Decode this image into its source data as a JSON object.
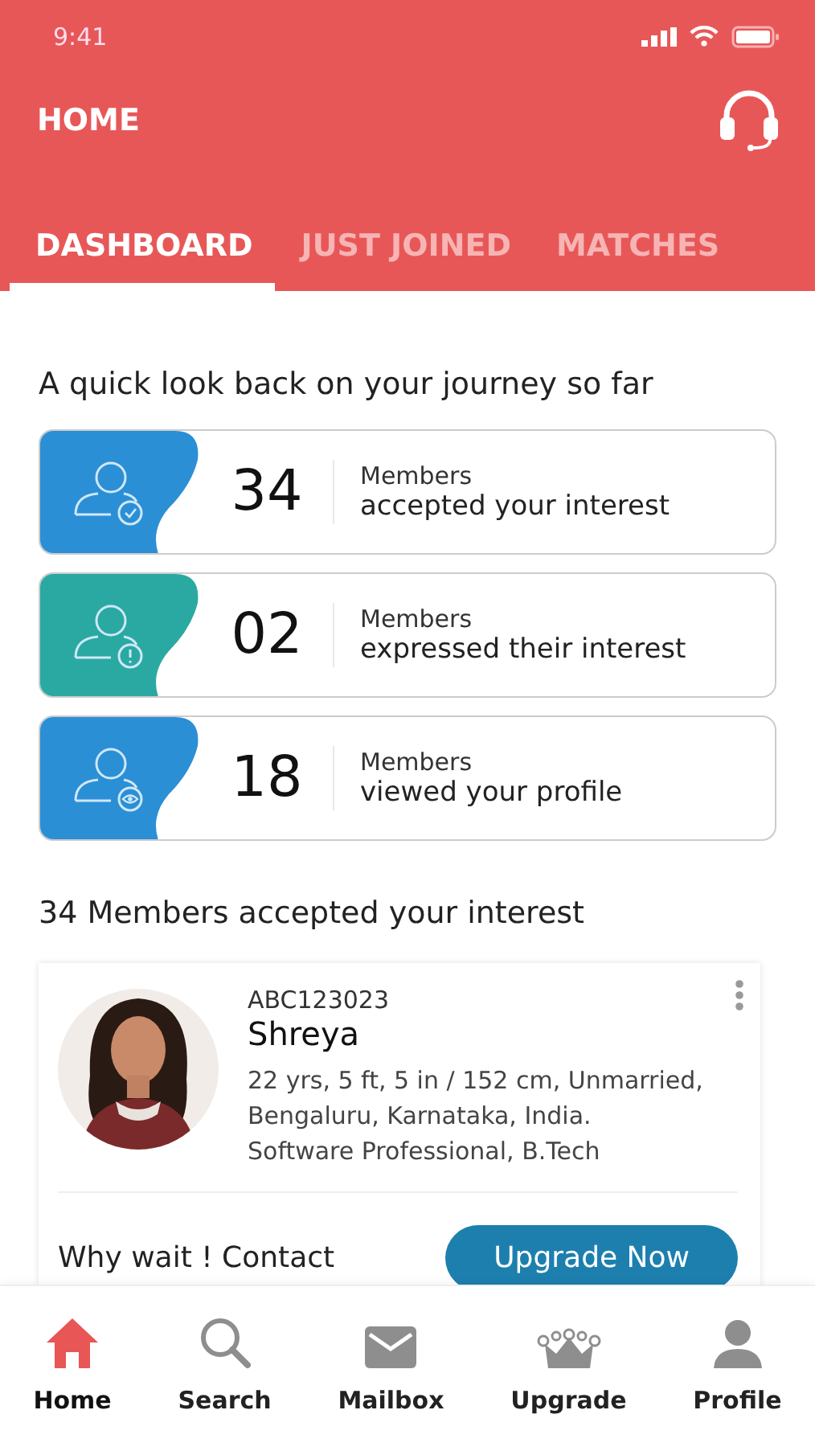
{
  "status_bar": {
    "time": "9:41"
  },
  "header": {
    "title": "HOME"
  },
  "tabs": [
    {
      "label": "DASHBOARD",
      "selected": true
    },
    {
      "label": "JUST JOINED",
      "selected": false
    },
    {
      "label": "MATCHES",
      "selected": false
    }
  ],
  "summary": {
    "heading": "A quick look back on your journey so far",
    "cards": [
      {
        "kind": "accepted",
        "color": "#2b8fd6",
        "count": "34",
        "label": "Members",
        "detail": "accepted your interest"
      },
      {
        "kind": "expressed",
        "color": "#2aa9a3",
        "count": "02",
        "label": "Members",
        "detail": "expressed their interest"
      },
      {
        "kind": "viewed",
        "color": "#2b8fd6",
        "count": "18",
        "label": "Members",
        "detail": "viewed your profile"
      }
    ]
  },
  "accepted_section": {
    "heading": "34 Members accepted your interest",
    "profile": {
      "id": "ABC123023",
      "name": "Shreya",
      "details": [
        "22 yrs, 5 ft, 5 in / 152 cm, Unmarried,",
        "Bengaluru, Karnataka, India.",
        "Software Professional, B.Tech"
      ],
      "prompt": "Why wait ! Contact",
      "button": "Upgrade Now"
    }
  },
  "bottom_nav": [
    {
      "kind": "home",
      "label": "Home",
      "selected": true
    },
    {
      "kind": "search",
      "label": "Search",
      "selected": false
    },
    {
      "kind": "mail",
      "label": "Mailbox",
      "selected": false
    },
    {
      "kind": "crown",
      "label": "Upgrade",
      "selected": false
    },
    {
      "kind": "person",
      "label": "Profile",
      "selected": false
    }
  ]
}
